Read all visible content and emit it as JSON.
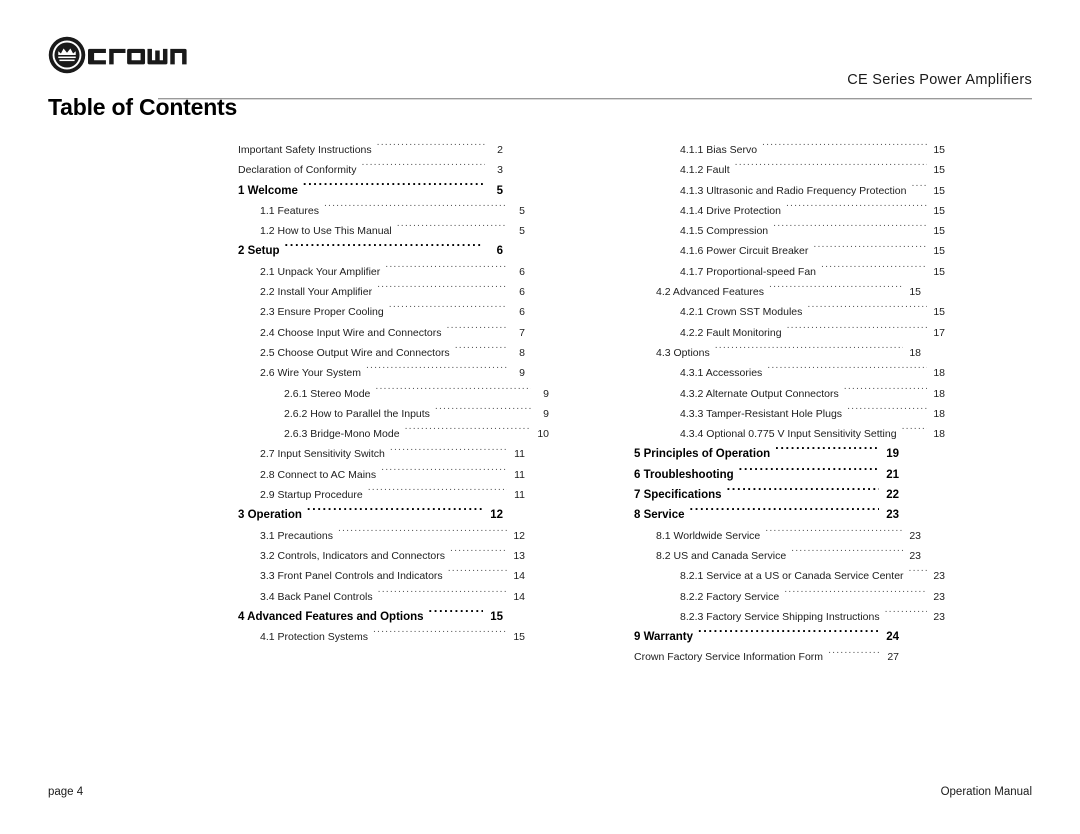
{
  "header": {
    "logo_icon": "crown-circle-logo-icon",
    "logo_wordmark": "crown",
    "title_part1": "CE Series",
    "title_part2": "Power Amplifiers"
  },
  "page_title": "Table of Contents",
  "footer": {
    "left": "page 4",
    "right": "Operation Manual"
  },
  "toc": {
    "left_column": [
      {
        "label": "Important Safety Instructions",
        "page": "2",
        "level": 1,
        "bold": false
      },
      {
        "label": "Declaration of Conformity",
        "page": "3",
        "level": 1,
        "bold": false
      },
      {
        "label": "1 Welcome",
        "page": "5",
        "level": 0,
        "bold": true
      },
      {
        "label": "1.1 Features",
        "page": "5",
        "level": 2,
        "bold": false
      },
      {
        "label": "1.2 How to Use This Manual",
        "page": "5",
        "level": 2,
        "bold": false
      },
      {
        "label": "2 Setup",
        "page": "6",
        "level": 0,
        "bold": true
      },
      {
        "label": "2.1 Unpack Your Amplifier",
        "page": "6",
        "level": 2,
        "bold": false
      },
      {
        "label": "2.2 Install Your Amplifier",
        "page": "6",
        "level": 2,
        "bold": false
      },
      {
        "label": "2.3 Ensure Proper Cooling",
        "page": "6",
        "level": 2,
        "bold": false
      },
      {
        "label": "2.4 Choose Input Wire and Connectors",
        "page": "7",
        "level": 2,
        "bold": false
      },
      {
        "label": "2.5 Choose Output Wire and Connectors",
        "page": "8",
        "level": 2,
        "bold": false
      },
      {
        "label": "2.6 Wire Your System",
        "page": "9",
        "level": 2,
        "bold": false
      },
      {
        "label": "2.6.1 Stereo Mode",
        "page": "9",
        "level": 3,
        "bold": false
      },
      {
        "label": "2.6.2 How to Parallel the Inputs",
        "page": "9",
        "level": 3,
        "bold": false
      },
      {
        "label": "2.6.3 Bridge-Mono Mode",
        "page": "10",
        "level": 3,
        "bold": false
      },
      {
        "label": "2.7 Input Sensitivity Switch",
        "page": "11",
        "level": 2,
        "bold": false
      },
      {
        "label": "2.8 Connect to AC Mains",
        "page": "11",
        "level": 2,
        "bold": false
      },
      {
        "label": "2.9 Startup Procedure",
        "page": "11",
        "level": 2,
        "bold": false
      },
      {
        "label": "3 Operation",
        "page": "12",
        "level": 0,
        "bold": true
      },
      {
        "label": "3.1 Precautions",
        "page": "12",
        "level": 2,
        "bold": false
      },
      {
        "label": "3.2 Controls, Indicators and Connectors",
        "page": "13",
        "level": 2,
        "bold": false
      },
      {
        "label": "3.3 Front Panel Controls and Indicators",
        "page": "14",
        "level": 2,
        "bold": false
      },
      {
        "label": "3.4 Back Panel Controls",
        "page": "14",
        "level": 2,
        "bold": false
      },
      {
        "label": "4 Advanced Features and Options",
        "page": "15",
        "level": 0,
        "bold": true
      },
      {
        "label": "4.1 Protection Systems",
        "page": "15",
        "level": 2,
        "bold": false
      }
    ],
    "right_column": [
      {
        "label": "4.1.1 Bias Servo",
        "page": "15",
        "level": 3,
        "bold": false
      },
      {
        "label": "4.1.2 Fault",
        "page": "15",
        "level": 3,
        "bold": false
      },
      {
        "label": "4.1.3 Ultrasonic and Radio Frequency Protection",
        "page": "15",
        "level": 3,
        "bold": false
      },
      {
        "label": "4.1.4 Drive Protection",
        "page": "15",
        "level": 3,
        "bold": false
      },
      {
        "label": "4.1.5 Compression",
        "page": "15",
        "level": 3,
        "bold": false
      },
      {
        "label": "4.1.6 Power Circuit Breaker",
        "page": "15",
        "level": 3,
        "bold": false
      },
      {
        "label": "4.1.7 Proportional-speed Fan",
        "page": "15",
        "level": 3,
        "bold": false
      },
      {
        "label": "4.2 Advanced Features",
        "page": "15",
        "level": 2,
        "bold": false
      },
      {
        "label": "4.2.1 Crown SST Modules",
        "page": "15",
        "level": 3,
        "bold": false
      },
      {
        "label": "4.2.2 Fault Monitoring",
        "page": "17",
        "level": 3,
        "bold": false
      },
      {
        "label": "4.3 Options",
        "page": "18",
        "level": 2,
        "bold": false
      },
      {
        "label": "4.3.1 Accessories",
        "page": "18",
        "level": 3,
        "bold": false
      },
      {
        "label": "4.3.2 Alternate Output Connectors",
        "page": "18",
        "level": 3,
        "bold": false
      },
      {
        "label": "4.3.3 Tamper-Resistant Hole Plugs",
        "page": "18",
        "level": 3,
        "bold": false
      },
      {
        "label": "4.3.4 Optional 0.775 V Input Sensitivity Setting",
        "page": "18",
        "level": 3,
        "bold": false
      },
      {
        "label": "5 Principles of Operation",
        "page": "19",
        "level": 0,
        "bold": true
      },
      {
        "label": "6 Troubleshooting",
        "page": "21",
        "level": 0,
        "bold": true
      },
      {
        "label": "7 Specifications",
        "page": "22",
        "level": 0,
        "bold": true
      },
      {
        "label": "8 Service",
        "page": "23",
        "level": 0,
        "bold": true
      },
      {
        "label": "8.1 Worldwide Service",
        "page": "23",
        "level": 2,
        "bold": false
      },
      {
        "label": "8.2 US and Canada Service",
        "page": "23",
        "level": 2,
        "bold": false
      },
      {
        "label": "8.2.1 Service at a US or Canada Service Center",
        "page": "23",
        "level": 3,
        "bold": false
      },
      {
        "label": "8.2.2 Factory Service",
        "page": "23",
        "level": 3,
        "bold": false
      },
      {
        "label": "8.2.3 Factory Service Shipping Instructions",
        "page": "23",
        "level": 3,
        "bold": false
      },
      {
        "label": "9 Warranty",
        "page": "24",
        "level": 0,
        "bold": true
      },
      {
        "label": "Crown Factory Service Information Form",
        "page": "27",
        "level": 1,
        "bold": false
      }
    ]
  }
}
